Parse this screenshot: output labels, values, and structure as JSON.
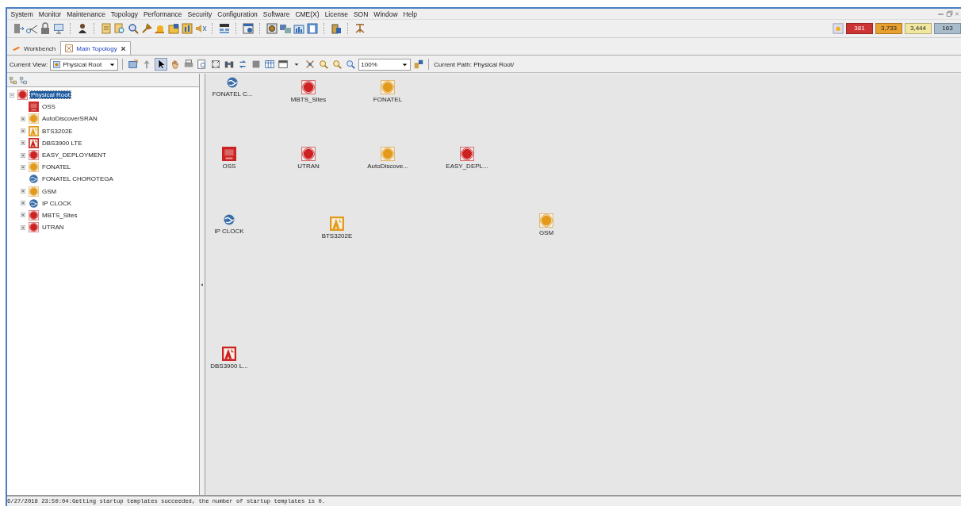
{
  "menu": [
    "System",
    "Monitor",
    "Maintenance",
    "Topology",
    "Performance",
    "Security",
    "Configuration",
    "Software",
    "CME(X)",
    "License",
    "SON",
    "Window",
    "Help"
  ],
  "alarm_counts": [
    {
      "value": "381",
      "color": "#cc3333"
    },
    {
      "value": "3,733",
      "color": "#e8a030"
    },
    {
      "value": "3,444",
      "color": "#f0e8a0"
    },
    {
      "value": "163",
      "color": "#a8bccc"
    }
  ],
  "tabs": [
    {
      "label": "Workbench",
      "selected": false,
      "closable": false
    },
    {
      "label": "Main Topology",
      "selected": true,
      "closable": true
    }
  ],
  "view_toolbar": {
    "current_view_label": "Current View:",
    "current_view": "Physical Root",
    "zoom": "100%",
    "current_path": "Current Path: Physical Root/"
  },
  "tree": [
    {
      "label": "Physical Root",
      "kind": "site",
      "color": "#cc2222",
      "expandable": true,
      "expanded": true,
      "selected": true,
      "children": [
        {
          "label": "OSS",
          "kind": "oss",
          "color": "#cc2222",
          "expandable": false,
          "selected": false
        },
        {
          "label": "AutoDiscoverSRAN",
          "kind": "site",
          "color": "#e39a1a",
          "expandable": true,
          "expanded": false,
          "selected": false
        },
        {
          "label": "BTS3202E",
          "kind": "tower",
          "color": "#e39a1a",
          "expandable": true,
          "expanded": false,
          "selected": false
        },
        {
          "label": "DBS3900 LTE",
          "kind": "tower",
          "color": "#cc2222",
          "expandable": true,
          "expanded": false,
          "selected": false
        },
        {
          "label": "EASY_DEPLOYMENT",
          "kind": "site",
          "color": "#cc2222",
          "expandable": true,
          "expanded": false,
          "selected": false
        },
        {
          "label": "FONATEL",
          "kind": "site",
          "color": "#e39a1a",
          "expandable": true,
          "expanded": false,
          "selected": false
        },
        {
          "label": "FONATEL CHOROTEGA",
          "kind": "globe",
          "color": "#3a6ea8",
          "expandable": false,
          "selected": false
        },
        {
          "label": "GSM",
          "kind": "site",
          "color": "#e39a1a",
          "expandable": true,
          "expanded": false,
          "selected": false
        },
        {
          "label": "IP CLOCK",
          "kind": "globe",
          "color": "#3a6ea8",
          "expandable": true,
          "expanded": false,
          "selected": false
        },
        {
          "label": "MBTS_Sites",
          "kind": "site",
          "color": "#cc2222",
          "expandable": true,
          "expanded": false,
          "selected": false
        },
        {
          "label": "UTRAN",
          "kind": "site",
          "color": "#cc2222",
          "expandable": true,
          "expanded": false,
          "selected": false
        }
      ]
    }
  ],
  "canvas_nodes": [
    {
      "label": "FONATEL C...",
      "kind": "globe",
      "color": "#3a6ea8"
    },
    {
      "label": "MBTS_Sites",
      "kind": "site",
      "color": "#cc2222"
    },
    {
      "label": "FONATEL",
      "kind": "site",
      "color": "#e39a1a"
    },
    {
      "label": "OSS",
      "kind": "oss",
      "color": "#cc2222"
    },
    {
      "label": "UTRAN",
      "kind": "site",
      "color": "#cc2222"
    },
    {
      "label": "AutoDiscove...",
      "kind": "site",
      "color": "#e39a1a"
    },
    {
      "label": "EASY_DEPL...",
      "kind": "site",
      "color": "#cc2222"
    },
    {
      "label": "IP CLOCK",
      "kind": "globe",
      "color": "#3a6ea8"
    },
    {
      "label": "BTS3202E",
      "kind": "tower",
      "color": "#e39a1a"
    },
    {
      "label": "GSM",
      "kind": "site",
      "color": "#e39a1a"
    },
    {
      "label": "DBS3900 L...",
      "kind": "tower",
      "color": "#cc2222"
    }
  ],
  "status_bar": "6/27/2018 23:50:04:Getting startup templates succeeded, the number of startup templates is 0."
}
